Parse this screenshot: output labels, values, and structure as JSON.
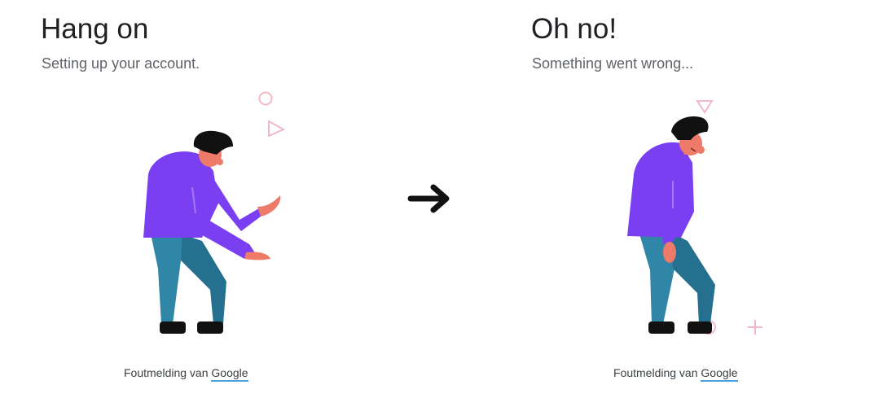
{
  "left_panel": {
    "title": "Hang on",
    "subtitle": "Setting up your account.",
    "caption_prefix": "Foutmelding van ",
    "caption_link": "Google"
  },
  "right_panel": {
    "title": "Oh no!",
    "subtitle": "Something went wrong...",
    "caption_prefix": "Foutmelding van ",
    "caption_link": "Google"
  },
  "transition_icon": "arrow-right-icon",
  "colors": {
    "sweater": "#7b3ff2",
    "pants": "#2f86a6",
    "skin": "#ee7a6a",
    "hair": "#111111",
    "accent_shapes": "#f2b8c6",
    "link_underline": "#4a9fe0"
  }
}
